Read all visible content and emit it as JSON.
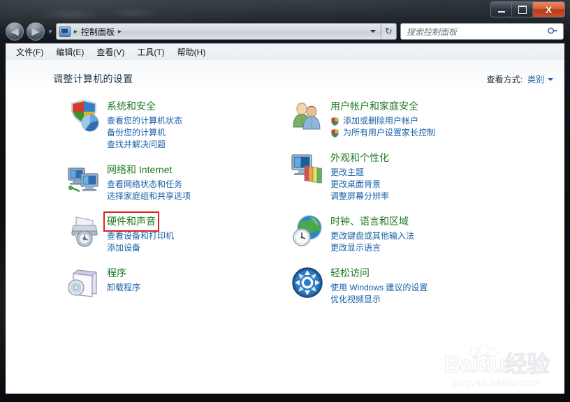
{
  "window": {
    "caption_buttons": {
      "minimize_label": "Minimize",
      "maximize_label": "Maximize",
      "close_label": "X"
    }
  },
  "navbar": {
    "back_glyph": "◀",
    "forward_glyph": "▶",
    "breadcrumb_root_sep": "▸",
    "breadcrumb": "控制面板",
    "breadcrumb_tail_sep": "▸",
    "refresh_glyph": "↻",
    "search_placeholder": "搜索控制面板",
    "search_value": "",
    "search_icon": "⚲"
  },
  "menubar": {
    "items": [
      {
        "label": "文件(F)"
      },
      {
        "label": "编辑(E)"
      },
      {
        "label": "查看(V)"
      },
      {
        "label": "工具(T)"
      },
      {
        "label": "帮助(H)"
      }
    ]
  },
  "content": {
    "page_title": "调整计算机的设置",
    "view_by": {
      "label": "查看方式:",
      "value": "类别"
    }
  },
  "categories_left": [
    {
      "icon": "security-shield-icon",
      "title": "系统和安全",
      "highlighted": false,
      "links": [
        {
          "label": "查看您的计算机状态",
          "shield": false
        },
        {
          "label": "备份您的计算机",
          "shield": false
        },
        {
          "label": "查找并解决问题",
          "shield": false
        }
      ]
    },
    {
      "icon": "network-icon",
      "title": "网络和 Internet",
      "highlighted": false,
      "links": [
        {
          "label": "查看网络状态和任务",
          "shield": false
        },
        {
          "label": "选择家庭组和共享选项",
          "shield": false
        }
      ]
    },
    {
      "icon": "hardware-sound-icon",
      "title": "硬件和声音",
      "highlighted": true,
      "links": [
        {
          "label": "查看设备和打印机",
          "shield": false
        },
        {
          "label": "添加设备",
          "shield": false
        }
      ]
    },
    {
      "icon": "programs-icon",
      "title": "程序",
      "highlighted": false,
      "links": [
        {
          "label": "卸载程序",
          "shield": false
        }
      ]
    }
  ],
  "categories_right": [
    {
      "icon": "user-accounts-icon",
      "title": "用户帐户和家庭安全",
      "highlighted": false,
      "links": [
        {
          "label": "添加或删除用户帐户",
          "shield": true
        },
        {
          "label": "为所有用户设置家长控制",
          "shield": true
        }
      ]
    },
    {
      "icon": "appearance-icon",
      "title": "外观和个性化",
      "highlighted": false,
      "links": [
        {
          "label": "更改主题",
          "shield": false
        },
        {
          "label": "更改桌面背景",
          "shield": false
        },
        {
          "label": "调整屏幕分辨率",
          "shield": false
        }
      ]
    },
    {
      "icon": "clock-language-icon",
      "title": "时钟、语言和区域",
      "highlighted": false,
      "links": [
        {
          "label": "更改键盘或其他输入法",
          "shield": false
        },
        {
          "label": "更改显示语言",
          "shield": false
        }
      ]
    },
    {
      "icon": "ease-of-access-icon",
      "title": "轻松访问",
      "highlighted": false,
      "links": [
        {
          "label": "使用 Windows 建议的设置",
          "shield": false
        },
        {
          "label": "优化视频显示",
          "shield": false
        }
      ]
    }
  ],
  "watermark": {
    "main": "Baidu经验",
    "sub": "jingyan.baidu.com"
  },
  "colors": {
    "category_title": "#1e7a22",
    "link": "#1860a8",
    "page_title": "#21374e",
    "highlight_box": "#e02020",
    "close_button": "#b53c18"
  }
}
